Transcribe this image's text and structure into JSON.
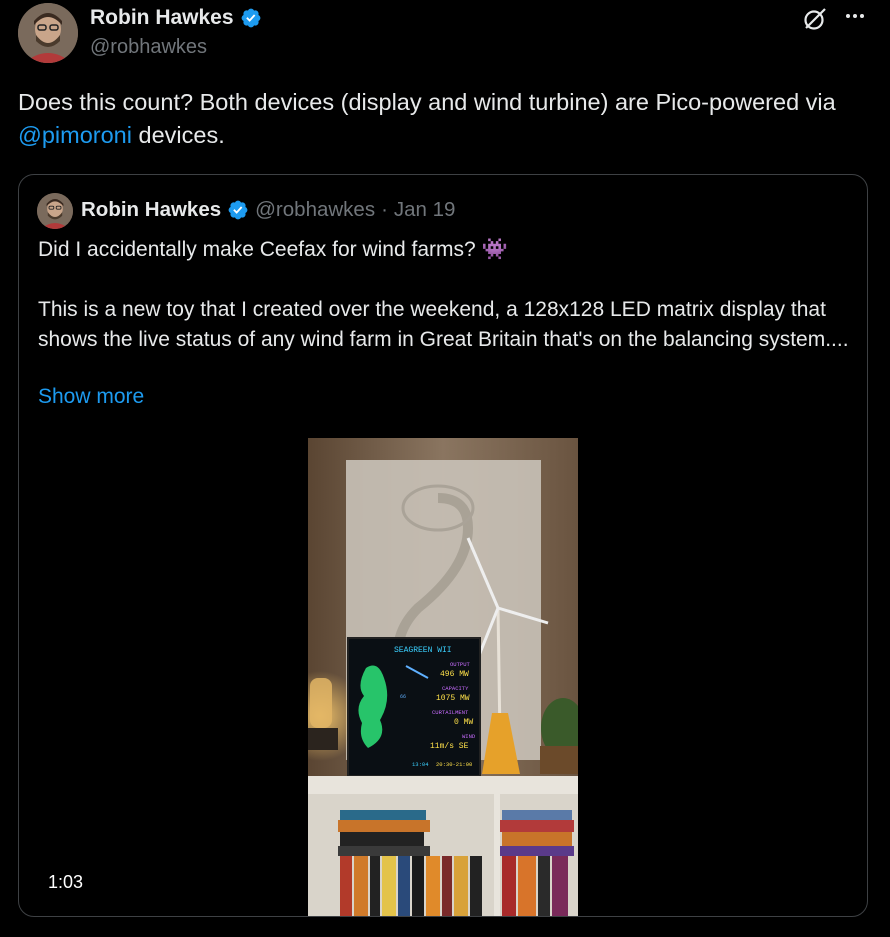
{
  "author": {
    "display_name": "Robin Hawkes",
    "handle": "@robhawkes",
    "verified_icon": "verified-badge-icon"
  },
  "actions": {
    "grok_icon": "grok-icon",
    "more_icon": "more-horizontal-icon"
  },
  "tweet": {
    "text_before": "Does this count? Both devices (display and wind turbine) are Pico-powered via ",
    "mention": "@pimoroni",
    "text_after": " devices."
  },
  "quote": {
    "display_name": "Robin Hawkes",
    "handle": "@robhawkes",
    "separator": "·",
    "date": "Jan 19",
    "text": "Did I accidentally make Ceefax for wind farms? 👾\n\nThis is a new toy that I created over the weekend, a 128x128 LED matrix display that shows the live status of any wind farm in Great Britain that's on the balancing system....",
    "show_more": "Show more",
    "video_duration": "1:03"
  },
  "led_display": {
    "title": "SEAGREEN WII",
    "output_label": "OUTPUT",
    "output_value": "496 MW",
    "capacity_label": "CAPACITY",
    "capacity_value": "1075 MW",
    "curtailment_label": "CURTAILMENT",
    "curtailment_value": "0 MW",
    "wind_label": "WIND",
    "wind_value": "11m/s SE",
    "footer_time": "13:04",
    "footer_range": "20:30-21:00",
    "map_marker": "66"
  },
  "colors": {
    "accent": "#1d9bf0",
    "text": "#e7e9ea",
    "muted": "#71767b",
    "border": "#3e4144"
  }
}
